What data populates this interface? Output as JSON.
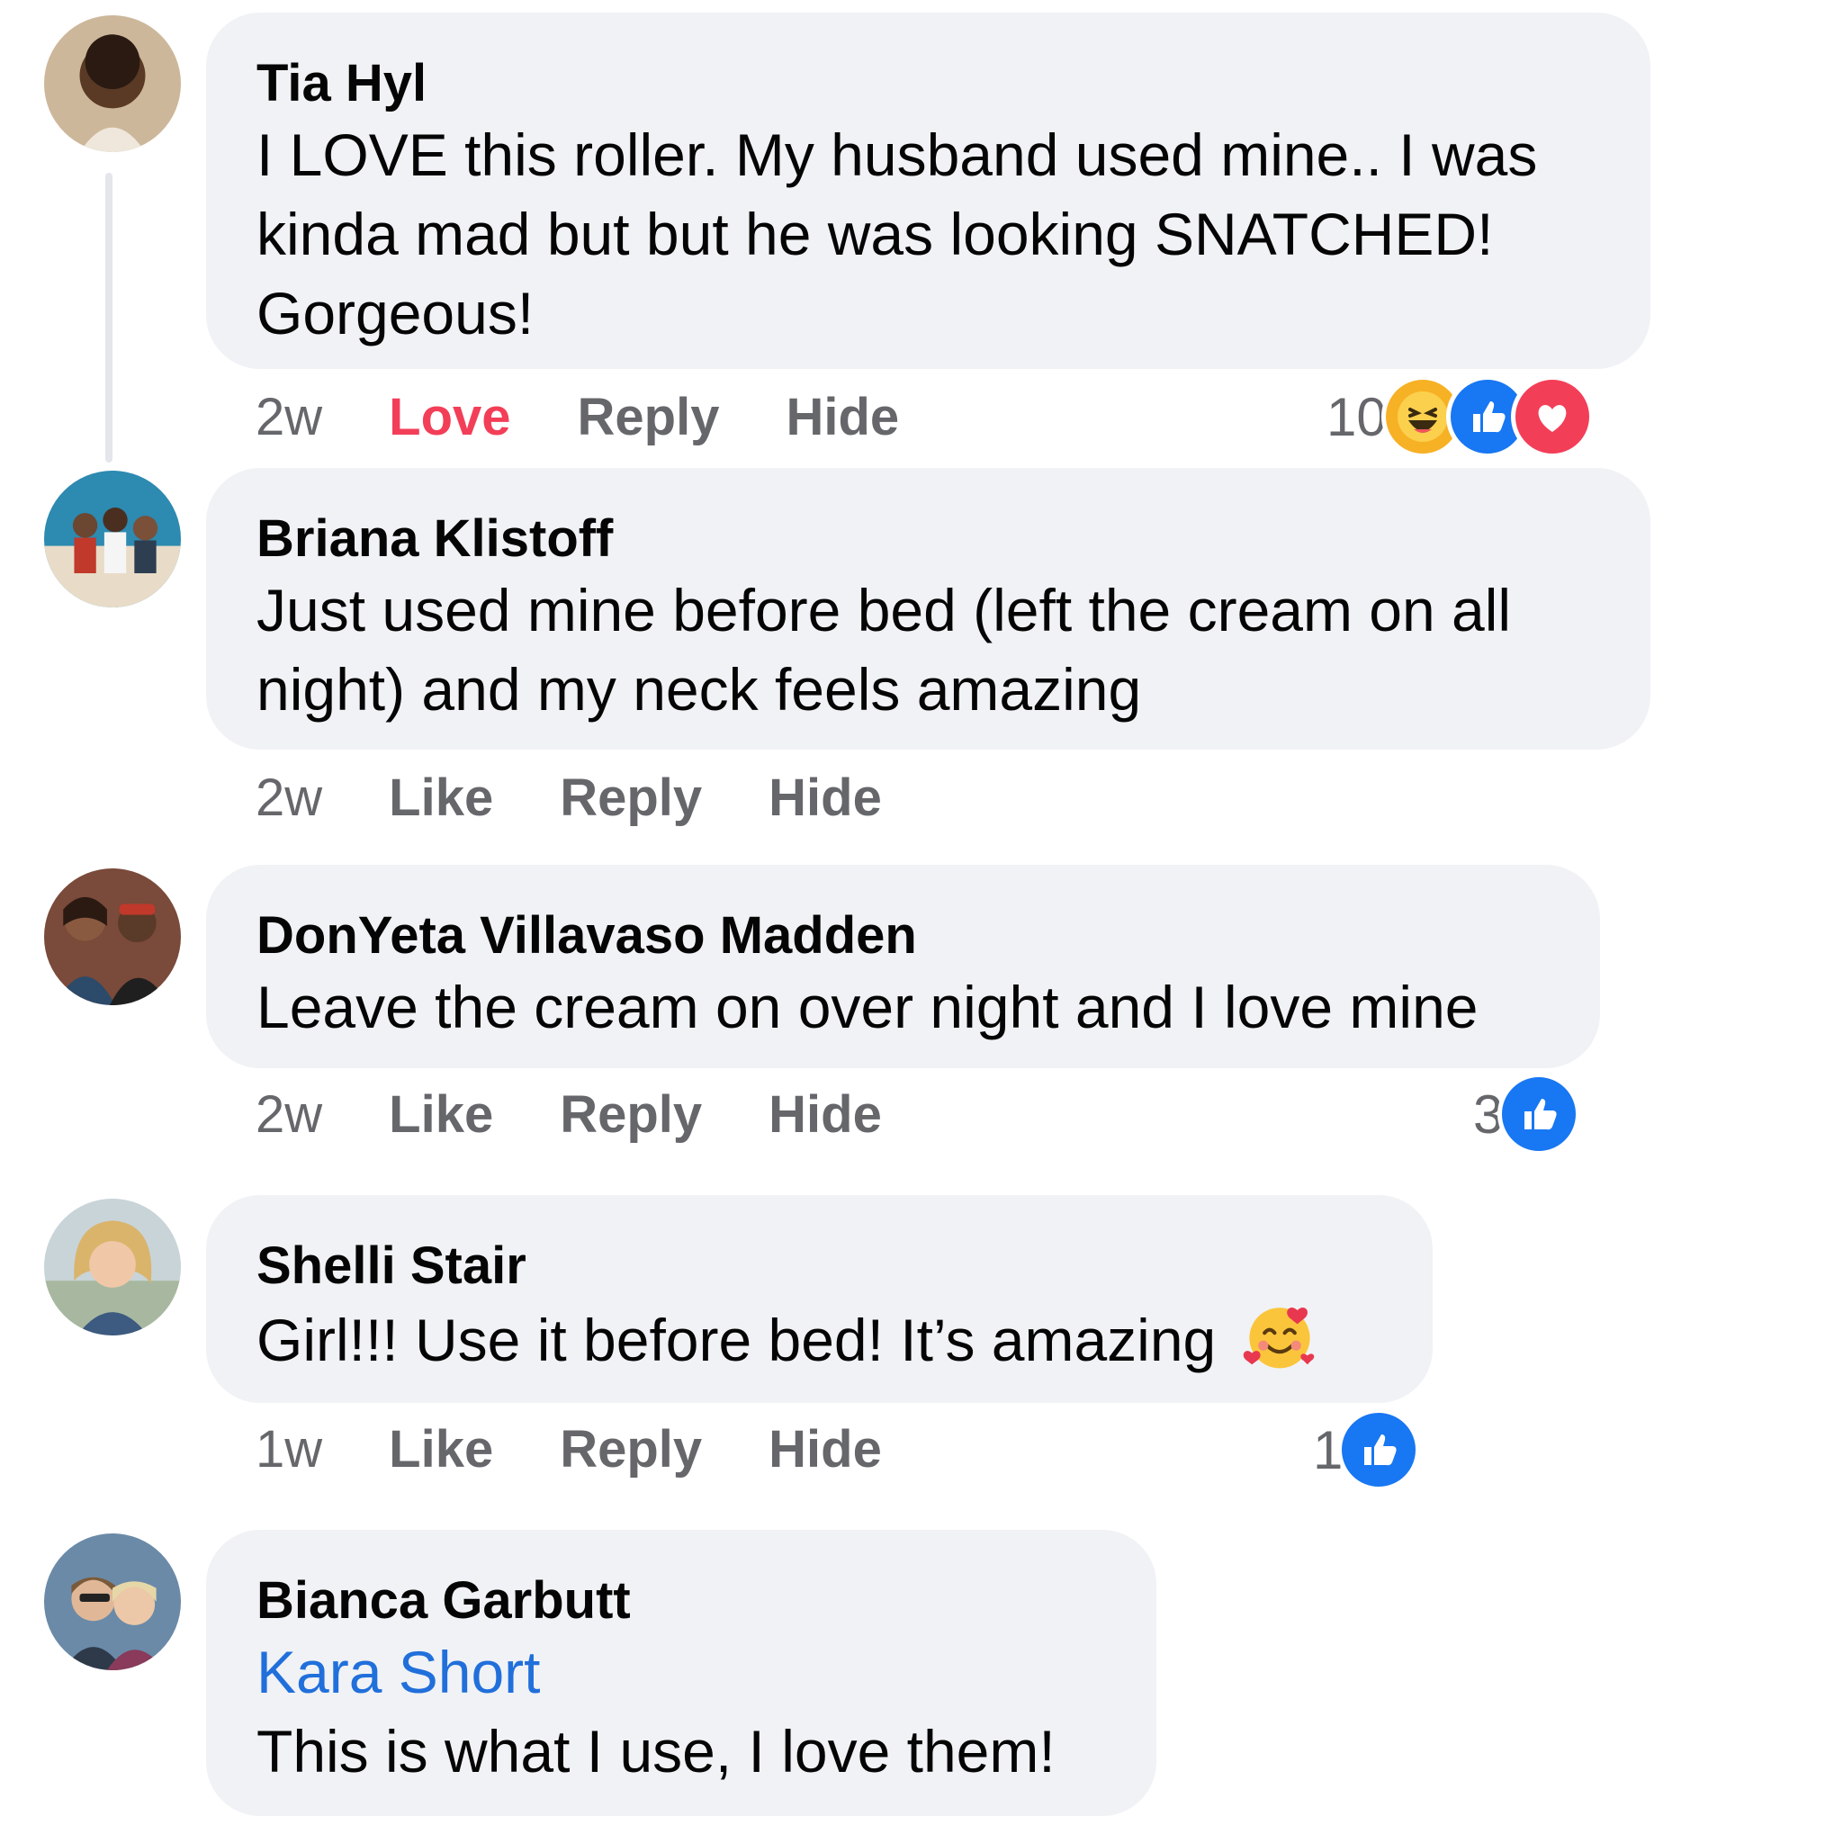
{
  "colors": {
    "bubble": "#f0f2f5",
    "meta": "#65676b",
    "love": "#f33e58",
    "like": "#1877f2",
    "mention": "#216fdb"
  },
  "comments": [
    {
      "author": "Tia Hyl",
      "text": "I LOVE this roller. My husband used mine.. I was kinda mad but but he was looking SNATCHED! Gorgeous!",
      "time": "2w",
      "like_label": "Love",
      "reply_label": "Reply",
      "hide_label": "Hide",
      "reaction_count": "10",
      "reactions": [
        "haha-icon",
        "like-icon",
        "love-icon"
      ]
    },
    {
      "author": "Briana Klistoff",
      "text": "Just used mine before bed (left the cream on all night) and my neck feels amazing",
      "time": "2w",
      "like_label": "Like",
      "reply_label": "Reply",
      "hide_label": "Hide"
    },
    {
      "author": "DonYeta Villavaso Madden",
      "text": "Leave the cream on over night and I love mine",
      "time": "2w",
      "like_label": "Like",
      "reply_label": "Reply",
      "hide_label": "Hide",
      "reaction_count": "3",
      "reactions": [
        "like-icon"
      ]
    },
    {
      "author": "Shelli Stair",
      "text": "Girl!!! Use it before bed! It’s amazing",
      "emoji": "smiling-face-with-hearts-icon",
      "time": "1w",
      "like_label": "Like",
      "reply_label": "Reply",
      "hide_label": "Hide",
      "reaction_count": "1",
      "reactions": [
        "like-icon"
      ]
    },
    {
      "author": "Bianca Garbutt",
      "mention": "Kara Short",
      "text": "This is what I use, I love them!"
    }
  ]
}
